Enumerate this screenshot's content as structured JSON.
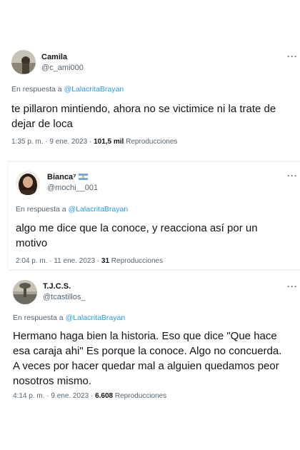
{
  "tweets": [
    {
      "name": "Camila",
      "handle": "@c_ami000",
      "reply_prefix": "En respuesta a",
      "reply_to": "@LalacritaBrayan",
      "text": "te pillaron mintiendo, ahora no se victimice ni la trate de dejar de loca",
      "time": "1:35 p. m. · 9 ene. 2023 ·",
      "views": "101,5 mil",
      "views_label": "Reproducciones",
      "more": "···"
    },
    {
      "name": "Bianca⁷",
      "handle": "@mochi__001",
      "flag_icon": "argentina-flag-emoji",
      "reply_prefix": "En respuesta a",
      "reply_to": "@LalacritaBrayan",
      "text": "algo me dice que la conoce, y reacciona así por un motivo",
      "time": "2:04 p. m. · 11 ene. 2023 ·",
      "views": "31",
      "views_label": "Reproducciones",
      "more": "···"
    },
    {
      "name": "T.J.C.S.",
      "handle": "@tcastillos_",
      "reply_prefix": "En respuesta a",
      "reply_to": "@LalacritaBrayan",
      "text": "Hermano haga bien la historia. Eso que dice \"Que hace esa caraja ahi\" Es porque la conoce. Algo no concuerda. A veces por hacer quedar mal a alguien quedamos peor nosotros mismo.",
      "time": "4:14 p. m. · 9 ene. 2023 ·",
      "views": "6.608",
      "views_label": "Reproducciones",
      "more": "···"
    }
  ]
}
